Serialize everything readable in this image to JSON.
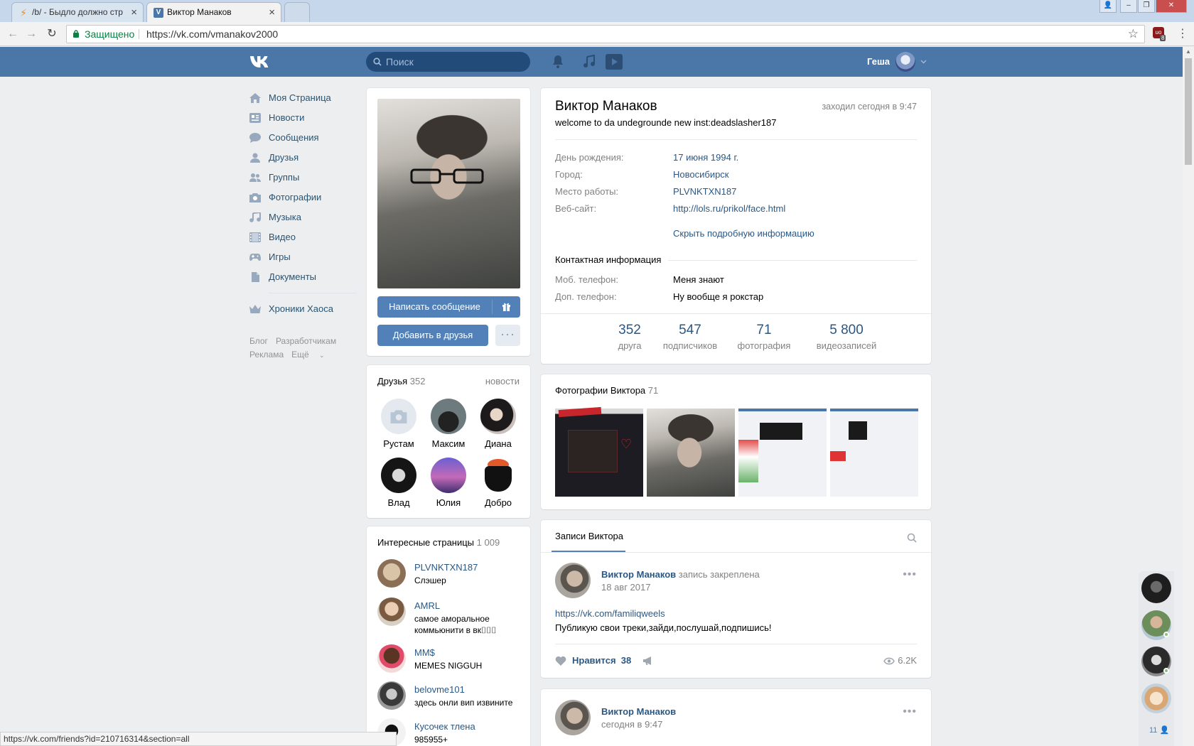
{
  "browser": {
    "tabs": [
      {
        "title": "/b/ - Быдло должно стр"
      },
      {
        "title": "Виктор Манаков"
      }
    ],
    "secure_label": "Защищено",
    "url": "https://vk.com/vmanakov2000",
    "status_url": "https://vk.com/friends?id=210716314&section=all",
    "ext_badge": "8"
  },
  "header": {
    "search_placeholder": "Поиск",
    "user_name": "Геша"
  },
  "left_menu": {
    "items": [
      {
        "label": "Моя Страница",
        "icon": "home-icon"
      },
      {
        "label": "Новости",
        "icon": "news-icon"
      },
      {
        "label": "Сообщения",
        "icon": "messages-icon"
      },
      {
        "label": "Друзья",
        "icon": "friends-icon"
      },
      {
        "label": "Группы",
        "icon": "groups-icon"
      },
      {
        "label": "Фотографии",
        "icon": "camera-icon"
      },
      {
        "label": "Музыка",
        "icon": "music-icon"
      },
      {
        "label": "Видео",
        "icon": "video-icon"
      },
      {
        "label": "Игры",
        "icon": "games-icon"
      },
      {
        "label": "Документы",
        "icon": "document-icon"
      }
    ],
    "extra_item": "Хроники Хаоса",
    "footer": [
      "Блог",
      "Разработчикам",
      "Реклама",
      "Ещё"
    ]
  },
  "profile_side": {
    "write_message": "Написать сообщение",
    "add_friend": "Добавить в друзья",
    "friends_title": "Друзья",
    "friends_count": "352",
    "friends_news": "новости",
    "friends": [
      {
        "name": "Рустам"
      },
      {
        "name": "Максим"
      },
      {
        "name": "Диана"
      },
      {
        "name": "Влад"
      },
      {
        "name": "Юлия"
      },
      {
        "name": "Добро"
      }
    ],
    "interesting_title": "Интересные страницы",
    "interesting_count": "1 009",
    "interesting": [
      {
        "name": "PLVNKTXN187",
        "desc": "Слэшер"
      },
      {
        "name": "AMRL",
        "desc": "самое аморальное коммьюнити в вк⌷⌷⌷"
      },
      {
        "name": "MM$",
        "desc": "MEMES NIGGUH"
      },
      {
        "name": "belovme101",
        "desc": "здесь онли вип извините"
      },
      {
        "name": "Кусочек тлена",
        "desc": "985955+"
      }
    ]
  },
  "profile": {
    "name": "Виктор Манаков",
    "status": "welcome to da undegrounde new inst:deadslasher187",
    "last_seen": "заходил сегодня в 9:47",
    "info": [
      {
        "label": "День рождения:",
        "value": "17 июня 1994 г."
      },
      {
        "label": "Город:",
        "value": "Новосибирск"
      },
      {
        "label": "Место работы:",
        "value": "PLVNKTXN187"
      },
      {
        "label": "Веб-сайт:",
        "value": "http://lols.ru/prikol/face.html"
      }
    ],
    "hide_info": "Скрыть подробную информацию",
    "contacts_title": "Контактная информация",
    "contacts": [
      {
        "label": "Моб. телефон:",
        "value": "Меня знают"
      },
      {
        "label": "Доп. телефон:",
        "value": "Ну вообще я рокстар"
      }
    ],
    "stats": [
      {
        "num": "352",
        "label": "друга"
      },
      {
        "num": "547",
        "label": "подписчиков"
      },
      {
        "num": "71",
        "label": "фотография"
      },
      {
        "num": "5 800",
        "label": "видеозаписей"
      }
    ]
  },
  "photos": {
    "title": "Фотографии Виктора",
    "count": "71"
  },
  "wall": {
    "tab": "Записи Виктора",
    "posts": [
      {
        "author": "Виктор Манаков",
        "note": "запись закреплена",
        "date": "18 авг 2017",
        "link": "https://vk.com/familiqweels",
        "text": "Публикую свои треки,зайди,послушай,подпишись!",
        "like_label": "Нравится",
        "likes": "38",
        "views": "6.2K"
      },
      {
        "author": "Виктор Манаков",
        "date": "сегодня в 9:47"
      }
    ]
  },
  "right_bar": {
    "friends_online_count": "11"
  },
  "colors": {
    "vk_blue": "#4a76a8",
    "link": "#2a5885",
    "button": "#5181b8",
    "background": "#edeef0"
  }
}
